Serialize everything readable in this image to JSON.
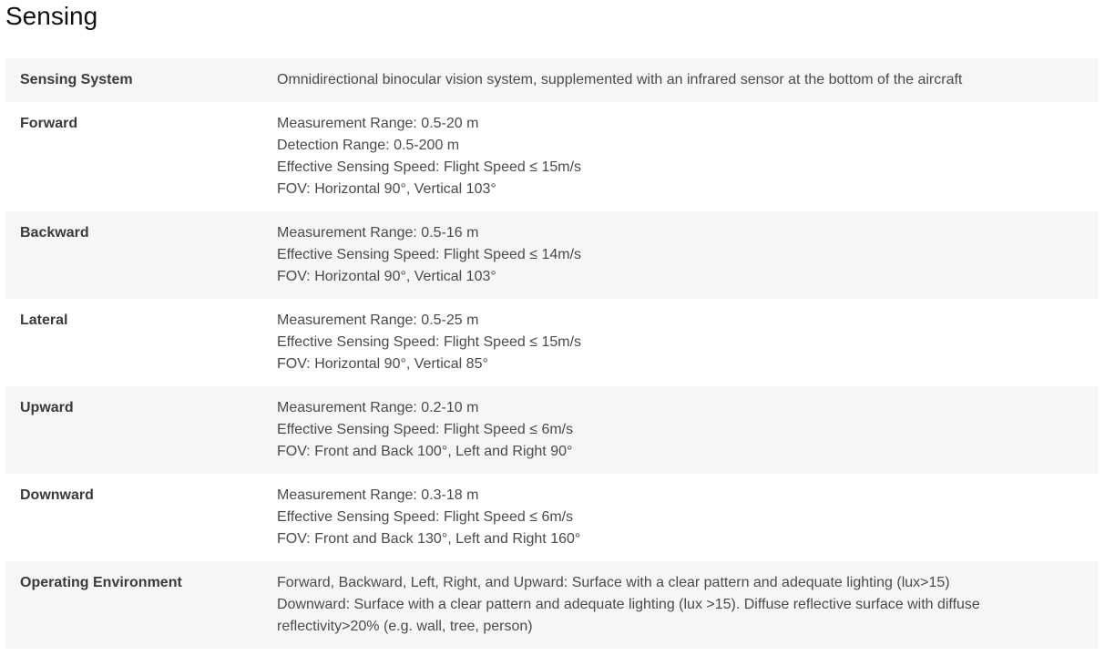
{
  "section": {
    "title": "Sensing"
  },
  "rows": [
    {
      "label": "Sensing System",
      "lines": [
        "Omnidirectional binocular vision system, supplemented with an infrared sensor at the bottom of the aircraft"
      ]
    },
    {
      "label": "Forward",
      "lines": [
        "Measurement Range: 0.5-20 m",
        "Detection Range: 0.5-200 m",
        "Effective Sensing Speed: Flight Speed ≤ 15m/s",
        "FOV: Horizontal 90°, Vertical 103°"
      ]
    },
    {
      "label": "Backward",
      "lines": [
        "Measurement Range: 0.5-16 m",
        "Effective Sensing Speed: Flight Speed ≤ 14m/s",
        "FOV: Horizontal 90°, Vertical 103°"
      ]
    },
    {
      "label": "Lateral",
      "lines": [
        "Measurement Range: 0.5-25 m",
        "Effective Sensing Speed: Flight Speed ≤ 15m/s",
        "FOV: Horizontal 90°, Vertical 85°"
      ]
    },
    {
      "label": "Upward",
      "lines": [
        "Measurement Range: 0.2-10 m",
        "Effective Sensing Speed: Flight Speed ≤ 6m/s",
        "FOV: Front and Back 100°, Left and Right 90°"
      ]
    },
    {
      "label": "Downward",
      "lines": [
        "Measurement Range: 0.3-18 m",
        "Effective Sensing Speed: Flight Speed ≤ 6m/s",
        "FOV: Front and Back 130°, Left and Right 160°"
      ]
    },
    {
      "label": "Operating Environment",
      "lines": [
        "Forward, Backward, Left, Right, and Upward: Surface with a clear pattern and adequate lighting (lux>15)",
        "Downward: Surface with a clear pattern and adequate lighting (lux >15). Diffuse reflective surface with diffuse reflectivity>20% (e.g. wall, tree, person)"
      ]
    }
  ]
}
